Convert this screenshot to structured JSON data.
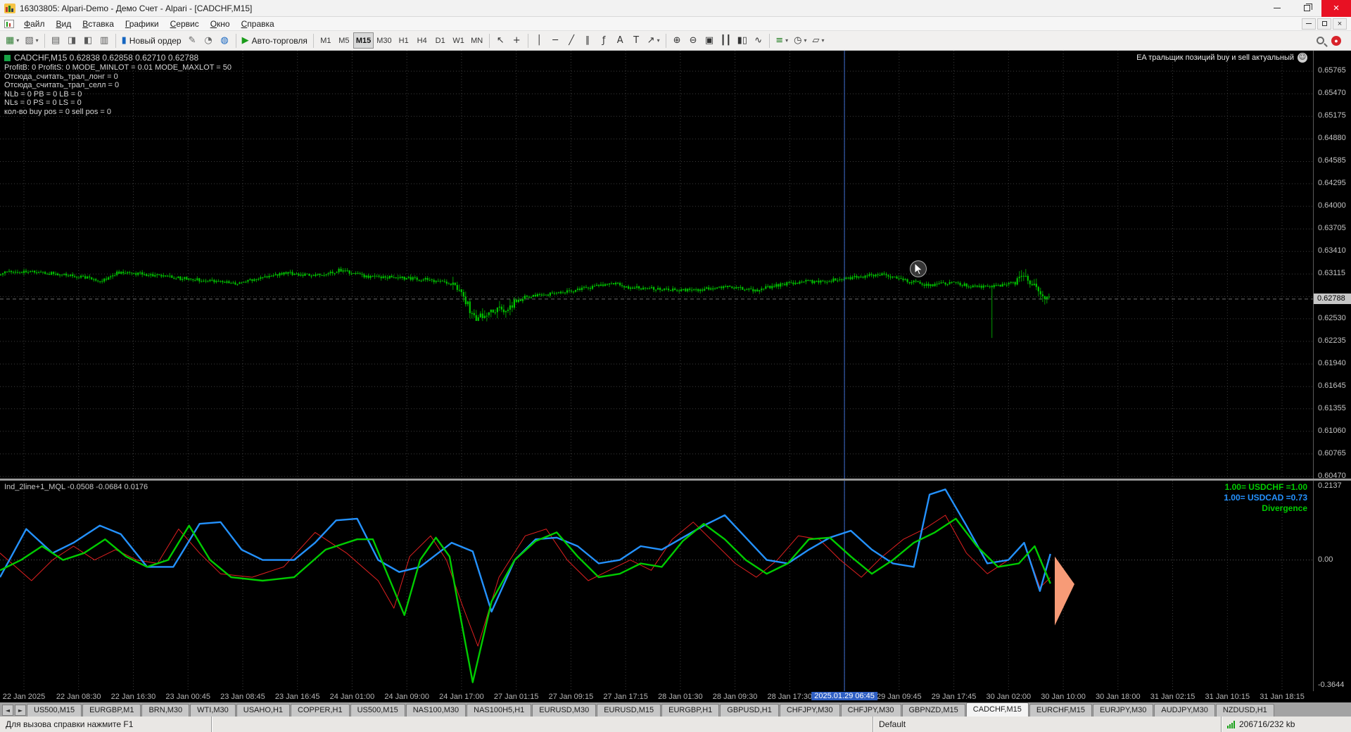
{
  "colors": {
    "grid": "#3c3c3c",
    "wick": "#009c00",
    "body": "#00c400",
    "bid_line": "#6d6d6d",
    "crosshair": "#3f6fd1",
    "indicator_red": "#e02020",
    "indicator_green": "#00cc00",
    "indicator_blue": "#2492ff",
    "zero_line": "#5a5a5a",
    "peach": "#f79b77",
    "highlight_bg": "#2f5fc4"
  },
  "titlebar": {
    "title": "16303805: Alpari-Demo - Демо Счет - Alpari - [CADCHF,M15]"
  },
  "menubar": {
    "items": [
      "Файл",
      "Вид",
      "Вставка",
      "Графики",
      "Сервис",
      "Окно",
      "Справка"
    ],
    "names": [
      "file",
      "view",
      "insert",
      "charts",
      "service",
      "window",
      "help"
    ]
  },
  "toolbar": {
    "new_order_label": "Новый ордер",
    "auto_trading_label": "Авто-торговля",
    "timeframes": [
      "M1",
      "M5",
      "M15",
      "M30",
      "H1",
      "H4",
      "D1",
      "W1",
      "MN"
    ],
    "active_timeframe": "M15",
    "groups": [
      {
        "items": [
          {
            "name": "new-chart",
            "glyph": "▦",
            "color": "#2e7d32",
            "dd": true
          },
          {
            "name": "profiles",
            "glyph": "▧",
            "color": "#5a5a5a",
            "dd": true
          }
        ]
      },
      {
        "items": [
          {
            "name": "market-watch",
            "glyph": "▤",
            "color": "#5a5a5a"
          },
          {
            "name": "data-window",
            "glyph": "◨",
            "color": "#5a5a5a"
          },
          {
            "name": "navigator",
            "glyph": "◧",
            "color": "#5a5a5a"
          },
          {
            "name": "terminal",
            "glyph": "▥",
            "color": "#5a5a5a"
          }
        ]
      },
      {
        "items": [
          {
            "name": "new-order",
            "glyph": "▮",
            "color": "#1565c0",
            "label_key": "new_order_label"
          },
          {
            "name": "metaeditor",
            "glyph": "✎",
            "color": "#666666"
          },
          {
            "name": "strategy-tester",
            "glyph": "◔",
            "color": "#666666"
          },
          {
            "name": "mql5-community",
            "glyph": "◍",
            "color": "#1565c0"
          }
        ]
      },
      {
        "items": [
          {
            "name": "auto-trading",
            "glyph": "▶",
            "color": "#1a9c1a",
            "label_key": "auto_trading_label"
          }
        ]
      },
      {
        "timeframes": true
      },
      {
        "items": [
          {
            "name": "cursor",
            "glyph": "↖",
            "color": "#333333"
          },
          {
            "name": "crosshair",
            "glyph": "+",
            "color": "#333333"
          }
        ]
      },
      {
        "items": [
          {
            "name": "vertical-line",
            "glyph": "│",
            "color": "#333333"
          },
          {
            "name": "horizontal-line",
            "glyph": "─",
            "color": "#333333"
          },
          {
            "name": "trendline",
            "glyph": "╱",
            "color": "#333333"
          },
          {
            "name": "equidistant-channel",
            "glyph": "∥",
            "color": "#333333"
          },
          {
            "name": "fibonacci",
            "glyph": "ƒ",
            "color": "#333333"
          },
          {
            "name": "text",
            "glyph": "A",
            "color": "#333333"
          },
          {
            "name": "text-label",
            "glyph": "T",
            "color": "#333333"
          },
          {
            "name": "arrows",
            "glyph": "↗",
            "color": "#333333",
            "dd": true
          }
        ]
      },
      {
        "items": [
          {
            "name": "zoom-in",
            "glyph": "⊕",
            "color": "#333333"
          },
          {
            "name": "zoom-out",
            "glyph": "⊖",
            "color": "#333333"
          },
          {
            "name": "tile-windows",
            "glyph": "▣",
            "color": "#333333"
          },
          {
            "name": "bar-chart",
            "glyph": "┃┃",
            "color": "#333333"
          },
          {
            "name": "candlesticks",
            "glyph": "▮▯",
            "color": "#333333"
          },
          {
            "name": "line-chart",
            "glyph": "∿",
            "color": "#333333"
          }
        ]
      },
      {
        "items": [
          {
            "name": "indicators-list",
            "glyph": "≡",
            "color": "#1a7a1a",
            "dd": true
          },
          {
            "name": "periods-list",
            "glyph": "◷",
            "color": "#333333",
            "dd": true
          },
          {
            "name": "templates",
            "glyph": "▱",
            "color": "#333333",
            "dd": true
          }
        ]
      }
    ]
  },
  "chart": {
    "header": "CADCHF,M15 0.62838 0.62858 0.62710 0.62788",
    "ea_name": "EA тральщик позиций buy и sell актуальный",
    "ea_comment": [
      "ProfitB: 0 ProfitS: 0 MODE_MINLOT = 0.01 MODE_MAXLOT = 50",
      "Отсюда_считать_трал_лонг = 0",
      "Отсюда_считать_трал_селл = 0",
      "NLb = 0 PB = 0 LB = 0",
      "NLs = 0 PS = 0 LS = 0",
      "кол-во buy pos = 0 sell pos = 0"
    ],
    "price_labels": [
      "0.65765",
      "0.65470",
      "0.65175",
      "0.64880",
      "0.64585",
      "0.64295",
      "0.64000",
      "0.63705",
      "0.63410",
      "0.63115",
      "0.62530",
      "0.62235",
      "0.61940",
      "0.61645",
      "0.61355",
      "0.61060",
      "0.60765",
      "0.60470"
    ],
    "hidden_grid_price": 0.6282,
    "bid_price": "0.62788",
    "bid_value": 0.62788,
    "price_top": 0.66033,
    "price_span": 0.05591,
    "data_fraction": 0.8,
    "price_anchors": [
      [
        0,
        0.6313
      ],
      [
        0.02,
        0.6315
      ],
      [
        0.05,
        0.6312
      ],
      [
        0.08,
        0.6308
      ],
      [
        0.095,
        0.6301
      ],
      [
        0.11,
        0.6313
      ],
      [
        0.14,
        0.6311
      ],
      [
        0.17,
        0.6306
      ],
      [
        0.2,
        0.6303
      ],
      [
        0.225,
        0.6299
      ],
      [
        0.25,
        0.6308
      ],
      [
        0.275,
        0.6313
      ],
      [
        0.3,
        0.6309
      ],
      [
        0.325,
        0.6317
      ],
      [
        0.345,
        0.6309
      ],
      [
        0.37,
        0.6307
      ],
      [
        0.4,
        0.6305
      ],
      [
        0.42,
        0.6302
      ],
      [
        0.433,
        0.6296
      ],
      [
        0.443,
        0.6278
      ],
      [
        0.452,
        0.6254
      ],
      [
        0.462,
        0.6259
      ],
      [
        0.48,
        0.6267
      ],
      [
        0.5,
        0.6281
      ],
      [
        0.52,
        0.6285
      ],
      [
        0.545,
        0.629
      ],
      [
        0.57,
        0.6296
      ],
      [
        0.585,
        0.6299
      ],
      [
        0.6,
        0.6294
      ],
      [
        0.625,
        0.6292
      ],
      [
        0.65,
        0.629
      ],
      [
        0.675,
        0.6292
      ],
      [
        0.7,
        0.6295
      ],
      [
        0.72,
        0.629
      ],
      [
        0.74,
        0.6297
      ],
      [
        0.765,
        0.6301
      ],
      [
        0.79,
        0.6303
      ],
      [
        0.815,
        0.6307
      ],
      [
        0.84,
        0.6311
      ],
      [
        0.862,
        0.6303
      ],
      [
        0.885,
        0.6297
      ],
      [
        0.905,
        0.63
      ],
      [
        0.925,
        0.6296
      ],
      [
        0.945,
        0.6295
      ],
      [
        0.958,
        0.6298
      ],
      [
        0.968,
        0.6301
      ],
      [
        0.978,
        0.6312
      ],
      [
        0.988,
        0.629
      ],
      [
        1,
        0.6279
      ]
    ],
    "spike_low": {
      "t": 0.945,
      "low": 0.6228
    },
    "spike_high": {
      "t": 0.978,
      "high": 0.6318
    }
  },
  "indicator": {
    "header": "Ind_2line+1_MQL -0.0508 -0.0684 0.0176",
    "legend": [
      {
        "text": "1.00= USDCHF =1.00",
        "color": "#00cc00"
      },
      {
        "text": "1.00= USDCAD =0.73",
        "color": "#2492ff"
      },
      {
        "text": "Divergence",
        "color": "#00cc00"
      }
    ],
    "scale_labels": [
      {
        "text": "0.2137",
        "value": 0.2137
      },
      {
        "text": "0.00",
        "value": 0
      },
      {
        "text": "-0.3644",
        "value": -0.3644
      }
    ],
    "value_top": 0.23004,
    "value_span": 0.6108,
    "series": {
      "red": [
        [
          0,
          0.02
        ],
        [
          0.03,
          -0.06
        ],
        [
          0.05,
          0
        ],
        [
          0.07,
          0.04
        ],
        [
          0.09,
          0
        ],
        [
          0.11,
          0.03
        ],
        [
          0.13,
          0
        ],
        [
          0.15,
          -0.01
        ],
        [
          0.17,
          0.09
        ],
        [
          0.19,
          0.02
        ],
        [
          0.21,
          -0.04
        ],
        [
          0.24,
          -0.05
        ],
        [
          0.27,
          -0.02
        ],
        [
          0.3,
          0.08
        ],
        [
          0.33,
          0.02
        ],
        [
          0.36,
          -0.06
        ],
        [
          0.375,
          -0.14
        ],
        [
          0.39,
          0.01
        ],
        [
          0.41,
          0.07
        ],
        [
          0.425,
          0
        ],
        [
          0.44,
          -0.13
        ],
        [
          0.455,
          -0.25
        ],
        [
          0.475,
          -0.05
        ],
        [
          0.5,
          0.07
        ],
        [
          0.52,
          0.09
        ],
        [
          0.54,
          0
        ],
        [
          0.56,
          -0.06
        ],
        [
          0.58,
          -0.03
        ],
        [
          0.6,
          0
        ],
        [
          0.62,
          -0.03
        ],
        [
          0.64,
          0.06
        ],
        [
          0.66,
          0.11
        ],
        [
          0.68,
          0.05
        ],
        [
          0.7,
          -0.01
        ],
        [
          0.72,
          -0.05
        ],
        [
          0.74,
          0
        ],
        [
          0.76,
          0.07
        ],
        [
          0.78,
          0.06
        ],
        [
          0.8,
          0
        ],
        [
          0.82,
          -0.05
        ],
        [
          0.84,
          0.01
        ],
        [
          0.86,
          0.06
        ],
        [
          0.88,
          0.09
        ],
        [
          0.9,
          0.13
        ],
        [
          0.92,
          0.02
        ],
        [
          0.94,
          -0.04
        ],
        [
          0.96,
          0
        ],
        [
          0.975,
          0.05
        ],
        [
          0.99,
          -0.08
        ],
        [
          1,
          -0.0508
        ]
      ],
      "green": [
        [
          0,
          -0.03
        ],
        [
          0.02,
          0
        ],
        [
          0.04,
          0.04
        ],
        [
          0.06,
          0
        ],
        [
          0.08,
          0.02
        ],
        [
          0.1,
          0.06
        ],
        [
          0.12,
          0.01
        ],
        [
          0.14,
          -0.02
        ],
        [
          0.16,
          0
        ],
        [
          0.18,
          0.1
        ],
        [
          0.2,
          0
        ],
        [
          0.22,
          -0.05
        ],
        [
          0.25,
          -0.06
        ],
        [
          0.28,
          -0.05
        ],
        [
          0.31,
          0.03
        ],
        [
          0.34,
          0.06
        ],
        [
          0.355,
          0.06
        ],
        [
          0.37,
          -0.05
        ],
        [
          0.385,
          -0.16
        ],
        [
          0.4,
          0
        ],
        [
          0.415,
          0.065
        ],
        [
          0.428,
          0.01
        ],
        [
          0.435,
          -0.11
        ],
        [
          0.45,
          -0.355
        ],
        [
          0.468,
          -0.12
        ],
        [
          0.49,
          0
        ],
        [
          0.51,
          0.055
        ],
        [
          0.53,
          0.08
        ],
        [
          0.55,
          0.01
        ],
        [
          0.57,
          -0.05
        ],
        [
          0.59,
          -0.04
        ],
        [
          0.61,
          -0.01
        ],
        [
          0.63,
          -0.02
        ],
        [
          0.65,
          0.055
        ],
        [
          0.67,
          0.105
        ],
        [
          0.69,
          0.06
        ],
        [
          0.71,
          0
        ],
        [
          0.73,
          -0.04
        ],
        [
          0.75,
          -0.01
        ],
        [
          0.77,
          0.06
        ],
        [
          0.79,
          0.065
        ],
        [
          0.81,
          0.01
        ],
        [
          0.83,
          -0.04
        ],
        [
          0.85,
          0
        ],
        [
          0.87,
          0.05
        ],
        [
          0.89,
          0.08
        ],
        [
          0.91,
          0.12
        ],
        [
          0.93,
          0.04
        ],
        [
          0.95,
          -0.02
        ],
        [
          0.97,
          -0.01
        ],
        [
          0.985,
          0.04
        ],
        [
          1,
          -0.0684
        ]
      ],
      "blue": [
        [
          0,
          -0.05
        ],
        [
          0.025,
          0.09
        ],
        [
          0.05,
          0.02
        ],
        [
          0.07,
          0.05
        ],
        [
          0.095,
          0.1
        ],
        [
          0.115,
          0.075
        ],
        [
          0.14,
          -0.02
        ],
        [
          0.165,
          -0.02
        ],
        [
          0.19,
          0.105
        ],
        [
          0.21,
          0.11
        ],
        [
          0.23,
          0.03
        ],
        [
          0.25,
          0
        ],
        [
          0.28,
          0
        ],
        [
          0.3,
          0.05
        ],
        [
          0.32,
          0.115
        ],
        [
          0.34,
          0.12
        ],
        [
          0.36,
          0
        ],
        [
          0.38,
          -0.035
        ],
        [
          0.4,
          -0.02
        ],
        [
          0.43,
          0.05
        ],
        [
          0.45,
          0.025
        ],
        [
          0.468,
          -0.15
        ],
        [
          0.49,
          0
        ],
        [
          0.51,
          0.06
        ],
        [
          0.53,
          0.065
        ],
        [
          0.55,
          0.04
        ],
        [
          0.57,
          -0.01
        ],
        [
          0.59,
          0
        ],
        [
          0.61,
          0.04
        ],
        [
          0.63,
          0.03
        ],
        [
          0.65,
          0.065
        ],
        [
          0.67,
          0.1
        ],
        [
          0.69,
          0.13
        ],
        [
          0.71,
          0.065
        ],
        [
          0.73,
          0
        ],
        [
          0.75,
          -0.01
        ],
        [
          0.77,
          0.03
        ],
        [
          0.79,
          0.065
        ],
        [
          0.81,
          0.085
        ],
        [
          0.83,
          0.03
        ],
        [
          0.85,
          -0.01
        ],
        [
          0.87,
          -0.02
        ],
        [
          0.885,
          0.19
        ],
        [
          0.9,
          0.205
        ],
        [
          0.92,
          0.1
        ],
        [
          0.94,
          -0.01
        ],
        [
          0.96,
          0
        ],
        [
          0.975,
          0.05
        ],
        [
          0.99,
          -0.09
        ],
        [
          1,
          0.0176
        ]
      ]
    }
  },
  "time_axis": {
    "labels": [
      "22 Jan 2025",
      "22 Jan 08:30",
      "22 Jan 16:30",
      "23 Jan 00:45",
      "23 Jan 08:45",
      "23 Jan 16:45",
      "24 Jan 01:00",
      "24 Jan 09:00",
      "24 Jan 17:00",
      "27 Jan 01:15",
      "27 Jan 09:15",
      "27 Jan 17:15",
      "28 Jan 01:30",
      "28 Jan 09:30",
      "28 Jan 17:30",
      "",
      "29 Jan 09:45",
      "29 Jan 17:45",
      "30 Jan 02:00",
      "30 Jan 10:00",
      "30 Jan 18:00",
      "31 Jan 02:15",
      "31 Jan 10:15",
      "31 Jan 18:15"
    ],
    "highlight_index": 15,
    "highlight_label": "2025.01.29 06:45"
  },
  "tabs": {
    "active_index": 16,
    "items": [
      "US500,M15",
      "EURGBP,M1",
      "BRN,M30",
      "WTI,M30",
      "USAHO,H1",
      "COPPER,H1",
      "US500,M15",
      "NAS100,M30",
      "NAS100H5,H1",
      "EURUSD,M30",
      "EURUSD,M15",
      "EURGBP,H1",
      "GBPUSD,H1",
      "CHFJPY,M30",
      "CHFJPY,M30",
      "GBPNZD,M15",
      "CADCHF,M15",
      "EURCHF,M15",
      "EURJPY,M30",
      "AUDJPY,M30",
      "NZDUSD,H1"
    ]
  },
  "statusbar": {
    "help": "Для вызова справки нажмите F1",
    "profile": "Default",
    "traffic": "206716/232 kb"
  }
}
